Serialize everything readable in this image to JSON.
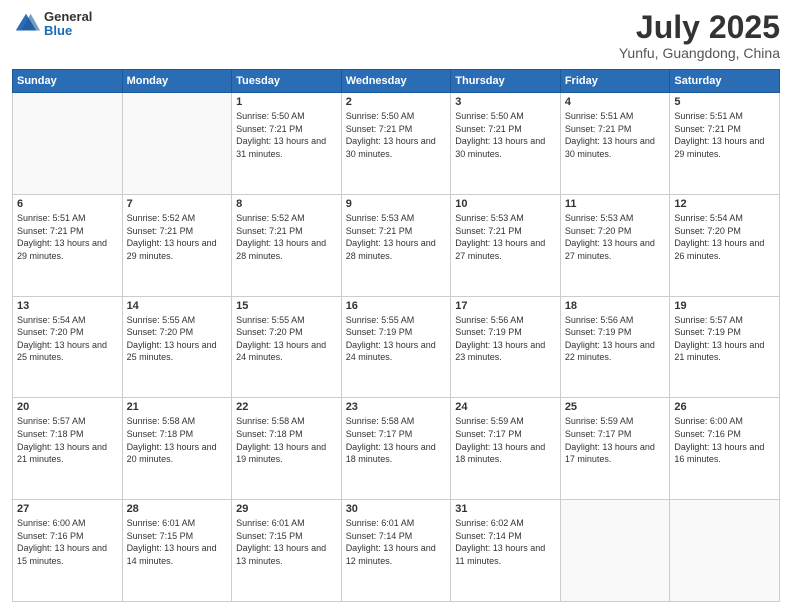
{
  "header": {
    "logo_general": "General",
    "logo_blue": "Blue",
    "month": "July 2025",
    "location": "Yunfu, Guangdong, China"
  },
  "days_of_week": [
    "Sunday",
    "Monday",
    "Tuesday",
    "Wednesday",
    "Thursday",
    "Friday",
    "Saturday"
  ],
  "weeks": [
    [
      {
        "day": "",
        "info": ""
      },
      {
        "day": "",
        "info": ""
      },
      {
        "day": "1",
        "info": "Sunrise: 5:50 AM\nSunset: 7:21 PM\nDaylight: 13 hours and 31 minutes."
      },
      {
        "day": "2",
        "info": "Sunrise: 5:50 AM\nSunset: 7:21 PM\nDaylight: 13 hours and 30 minutes."
      },
      {
        "day": "3",
        "info": "Sunrise: 5:50 AM\nSunset: 7:21 PM\nDaylight: 13 hours and 30 minutes."
      },
      {
        "day": "4",
        "info": "Sunrise: 5:51 AM\nSunset: 7:21 PM\nDaylight: 13 hours and 30 minutes."
      },
      {
        "day": "5",
        "info": "Sunrise: 5:51 AM\nSunset: 7:21 PM\nDaylight: 13 hours and 29 minutes."
      }
    ],
    [
      {
        "day": "6",
        "info": "Sunrise: 5:51 AM\nSunset: 7:21 PM\nDaylight: 13 hours and 29 minutes."
      },
      {
        "day": "7",
        "info": "Sunrise: 5:52 AM\nSunset: 7:21 PM\nDaylight: 13 hours and 29 minutes."
      },
      {
        "day": "8",
        "info": "Sunrise: 5:52 AM\nSunset: 7:21 PM\nDaylight: 13 hours and 28 minutes."
      },
      {
        "day": "9",
        "info": "Sunrise: 5:53 AM\nSunset: 7:21 PM\nDaylight: 13 hours and 28 minutes."
      },
      {
        "day": "10",
        "info": "Sunrise: 5:53 AM\nSunset: 7:21 PM\nDaylight: 13 hours and 27 minutes."
      },
      {
        "day": "11",
        "info": "Sunrise: 5:53 AM\nSunset: 7:20 PM\nDaylight: 13 hours and 27 minutes."
      },
      {
        "day": "12",
        "info": "Sunrise: 5:54 AM\nSunset: 7:20 PM\nDaylight: 13 hours and 26 minutes."
      }
    ],
    [
      {
        "day": "13",
        "info": "Sunrise: 5:54 AM\nSunset: 7:20 PM\nDaylight: 13 hours and 25 minutes."
      },
      {
        "day": "14",
        "info": "Sunrise: 5:55 AM\nSunset: 7:20 PM\nDaylight: 13 hours and 25 minutes."
      },
      {
        "day": "15",
        "info": "Sunrise: 5:55 AM\nSunset: 7:20 PM\nDaylight: 13 hours and 24 minutes."
      },
      {
        "day": "16",
        "info": "Sunrise: 5:55 AM\nSunset: 7:19 PM\nDaylight: 13 hours and 24 minutes."
      },
      {
        "day": "17",
        "info": "Sunrise: 5:56 AM\nSunset: 7:19 PM\nDaylight: 13 hours and 23 minutes."
      },
      {
        "day": "18",
        "info": "Sunrise: 5:56 AM\nSunset: 7:19 PM\nDaylight: 13 hours and 22 minutes."
      },
      {
        "day": "19",
        "info": "Sunrise: 5:57 AM\nSunset: 7:19 PM\nDaylight: 13 hours and 21 minutes."
      }
    ],
    [
      {
        "day": "20",
        "info": "Sunrise: 5:57 AM\nSunset: 7:18 PM\nDaylight: 13 hours and 21 minutes."
      },
      {
        "day": "21",
        "info": "Sunrise: 5:58 AM\nSunset: 7:18 PM\nDaylight: 13 hours and 20 minutes."
      },
      {
        "day": "22",
        "info": "Sunrise: 5:58 AM\nSunset: 7:18 PM\nDaylight: 13 hours and 19 minutes."
      },
      {
        "day": "23",
        "info": "Sunrise: 5:58 AM\nSunset: 7:17 PM\nDaylight: 13 hours and 18 minutes."
      },
      {
        "day": "24",
        "info": "Sunrise: 5:59 AM\nSunset: 7:17 PM\nDaylight: 13 hours and 18 minutes."
      },
      {
        "day": "25",
        "info": "Sunrise: 5:59 AM\nSunset: 7:17 PM\nDaylight: 13 hours and 17 minutes."
      },
      {
        "day": "26",
        "info": "Sunrise: 6:00 AM\nSunset: 7:16 PM\nDaylight: 13 hours and 16 minutes."
      }
    ],
    [
      {
        "day": "27",
        "info": "Sunrise: 6:00 AM\nSunset: 7:16 PM\nDaylight: 13 hours and 15 minutes."
      },
      {
        "day": "28",
        "info": "Sunrise: 6:01 AM\nSunset: 7:15 PM\nDaylight: 13 hours and 14 minutes."
      },
      {
        "day": "29",
        "info": "Sunrise: 6:01 AM\nSunset: 7:15 PM\nDaylight: 13 hours and 13 minutes."
      },
      {
        "day": "30",
        "info": "Sunrise: 6:01 AM\nSunset: 7:14 PM\nDaylight: 13 hours and 12 minutes."
      },
      {
        "day": "31",
        "info": "Sunrise: 6:02 AM\nSunset: 7:14 PM\nDaylight: 13 hours and 11 minutes."
      },
      {
        "day": "",
        "info": ""
      },
      {
        "day": "",
        "info": ""
      }
    ]
  ]
}
